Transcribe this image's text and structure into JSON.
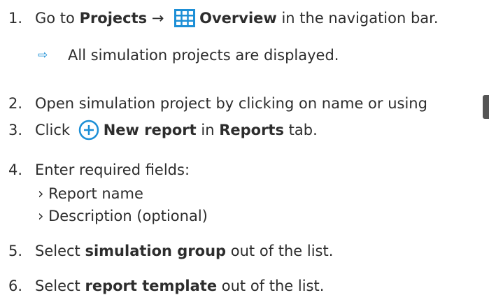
{
  "steps": [
    {
      "num": "1.",
      "pre": "Go to ",
      "b1": "Projects",
      "arrow": " → ",
      "b2": "Overview",
      "post": " in the navigation bar."
    },
    {
      "result_arrow": "⇨",
      "result_text": "All simulation projects are displayed."
    },
    {
      "num": "2.",
      "text": "Open simulation project by clicking on name or using"
    },
    {
      "num": "3.",
      "pre": "Click ",
      "b1": "New report",
      "mid": " in ",
      "b2": "Reports",
      "post": " tab."
    },
    {
      "num": "4.",
      "text": "Enter required fields:",
      "items": [
        "› Report name",
        "› Description (optional)"
      ]
    },
    {
      "num": "5.",
      "pre": "Select ",
      "b1": "simulation group",
      "post": " out of the list."
    },
    {
      "num": "6.",
      "pre": "Select ",
      "b1": "report template",
      "post": " out of the list."
    }
  ],
  "icons": {
    "grid": "grid-table-icon",
    "plus": "plus-circle-icon"
  },
  "colors": {
    "icon": "#1d8fd6",
    "text": "#2d2d2d"
  }
}
